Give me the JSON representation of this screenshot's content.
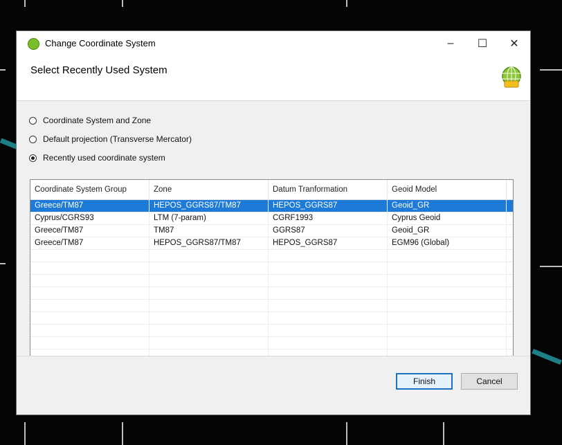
{
  "window": {
    "title": "Change Coordinate System",
    "minimize_glyph": "–",
    "maximize_glyph": "☐",
    "close_glyph": "✕"
  },
  "header": {
    "title": "Select Recently Used System",
    "icon": "globe-icon"
  },
  "options": [
    {
      "label": "Coordinate System and Zone",
      "checked": false
    },
    {
      "label": "Default projection (Transverse Mercator)",
      "checked": false
    },
    {
      "label": "Recently used coordinate system",
      "checked": true
    }
  ],
  "table": {
    "columns": [
      "Coordinate System Group",
      "Zone",
      "Datum Tranformation",
      "Geoid Model"
    ],
    "rows": [
      [
        "Greece/TM87",
        "HEPOS_GGRS87/TM87",
        "HEPOS_GGRS87",
        "Geoid_GR"
      ],
      [
        "Cyprus/CGRS93",
        "LTM (7-param)",
        "CGRF1993",
        "Cyprus Geoid"
      ],
      [
        "Greece/TM87",
        "TM87",
        "GGRS87",
        "Geoid_GR"
      ],
      [
        "Greece/TM87",
        "HEPOS_GGRS87/TM87",
        "HEPOS_GGRS87",
        "EGM96 (Global)"
      ]
    ],
    "selected_row": 0,
    "empty_rows": 10
  },
  "footer": {
    "finish_label": "Finish",
    "cancel_label": "Cancel"
  },
  "colors": {
    "selection": "#1e7ad7",
    "accent": "#1b70c4"
  }
}
